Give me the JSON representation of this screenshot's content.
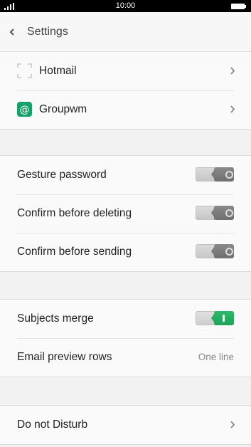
{
  "status_bar": {
    "time": "10:00"
  },
  "header": {
    "title": "Settings"
  },
  "accounts": [
    {
      "label": "Hotmail",
      "icon": "placeholder-icon"
    },
    {
      "label": "Groupwm",
      "icon": "at-sign-icon",
      "icon_color": "#18a06a"
    }
  ],
  "security": [
    {
      "label": "Gesture password",
      "toggle": false
    },
    {
      "label": "Confirm before deleting",
      "toggle": false
    },
    {
      "label": "Confirm before sending",
      "toggle": false
    }
  ],
  "display": {
    "subjects_merge": {
      "label": "Subjects merge",
      "toggle": true
    },
    "preview_rows": {
      "label": "Email preview rows",
      "value": "One line"
    }
  },
  "other": [
    {
      "label": "Do not Disturb"
    }
  ],
  "colors": {
    "accent": "#25ab62",
    "background": "#f2f2f2"
  }
}
